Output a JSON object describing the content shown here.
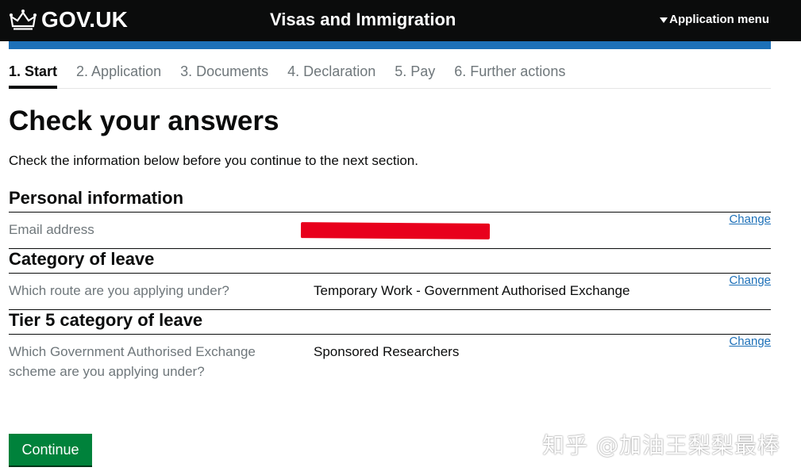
{
  "header": {
    "logo_text": "GOV.UK",
    "service_name": "Visas and Immigration",
    "menu_label": "Application menu"
  },
  "steps": [
    {
      "label": "1. Start",
      "active": true
    },
    {
      "label": "2. Application",
      "active": false
    },
    {
      "label": "3. Documents",
      "active": false
    },
    {
      "label": "4. Declaration",
      "active": false
    },
    {
      "label": "5. Pay",
      "active": false
    },
    {
      "label": "6. Further actions",
      "active": false
    }
  ],
  "page": {
    "title": "Check your answers",
    "lede": "Check the information below before you continue to the next section."
  },
  "sections": [
    {
      "heading": "Personal information",
      "rows": [
        {
          "key": "Email address",
          "value": "",
          "change": "Change",
          "redacted": true
        }
      ]
    },
    {
      "heading": "Category of leave",
      "rows": [
        {
          "key": "Which route are you applying under?",
          "value": "Temporary Work - Government Authorised Exchange",
          "change": "Change"
        }
      ]
    },
    {
      "heading": "Tier 5 category of leave",
      "rows": [
        {
          "key": "Which Government Authorised Exchange scheme are you applying under?",
          "value": "Sponsored Researchers",
          "change": "Change"
        }
      ]
    }
  ],
  "actions": {
    "continue_label": "Continue"
  },
  "watermark": "知乎 @加油王梨梨最棒",
  "colors": {
    "header_bg": "#0b0c0c",
    "brand_blue": "#1d70b8",
    "button_green": "#00823b",
    "redaction_red": "#e8001c"
  }
}
